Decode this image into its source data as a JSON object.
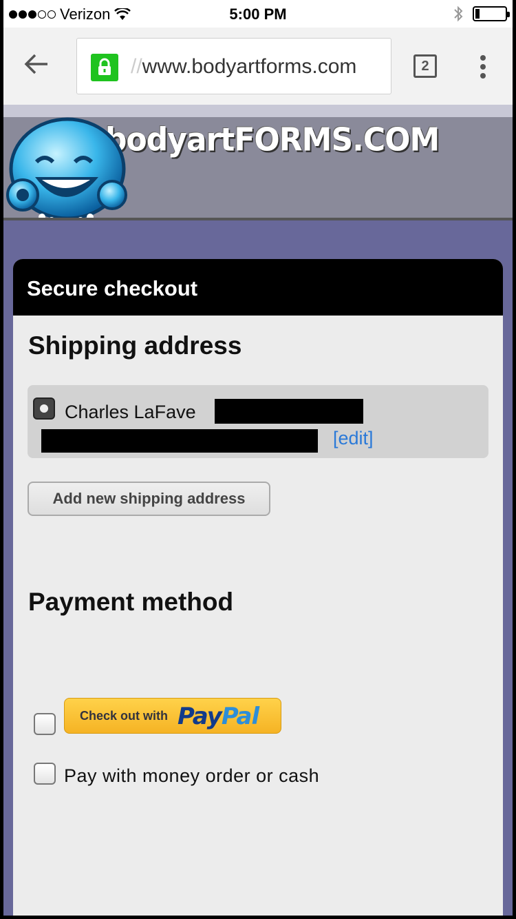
{
  "status_bar": {
    "carrier": "Verizon",
    "time": "5:00 PM",
    "signal_bars_filled": 3,
    "signal_bars_total": 5
  },
  "browser": {
    "url_prefix": "//",
    "url": "www.bodyartforms.com",
    "tab_count": "2",
    "secure": true
  },
  "site": {
    "logo_text": "bodyartFORMS.COM"
  },
  "checkout": {
    "header": "Secure checkout",
    "shipping_title": "Shipping address",
    "address": {
      "name": "Charles LaFave",
      "edit_label": "[edit]",
      "selected": true
    },
    "add_address_label": "Add new shipping address",
    "payment_title": "Payment method",
    "paypal": {
      "small_label": "Check out with",
      "pay": "Pay",
      "pal": "Pal",
      "checked": false
    },
    "money_order": {
      "label": "Pay with money order or cash",
      "checked": false
    }
  },
  "colors": {
    "accent_link": "#2a79d8",
    "page_bg": "#68689a",
    "lock_green": "#1fc31f",
    "paypal_yellow": "#ffc439"
  }
}
